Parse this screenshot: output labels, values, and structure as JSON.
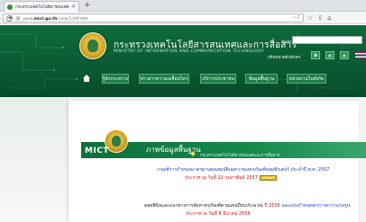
{
  "browser": {
    "tab_title": "กระทรวงเทคโนโลยีสารสนเทศ...",
    "tab_close": "×",
    "new_tab": "+",
    "url_prefix": "www.",
    "url_domain": "mict.go.th",
    "url_path": "/view/1/หน้าหลัก",
    "url_actions": "▿ C",
    "toolbar_icons": [
      "star-icon",
      "download-icon",
      "home-icon"
    ],
    "toolbar_glyphs": [
      "☆",
      "⇩",
      "⌂"
    ]
  },
  "header": {
    "title_th": "กระทรวงเทคโนโลยีสารสนเทศและการสื่อสาร",
    "title_en": "MINISTRY OF INFORMATION AND COMMUNICATION TECHNOLOGY",
    "search_label": "ค้นหา",
    "font_size_label": "ปรับขนาดตัวอักษร",
    "font_buttons": [
      "a",
      "ก",
      "ก"
    ],
    "menu": [
      "รู้จักกระทรวง",
      "ข่าวสารความเคลื่อนไหว",
      "บริการประชาชน",
      "ข้อมูลพื้นฐาน",
      "หน่วยงานในสังกัด"
    ]
  },
  "banner": {
    "logo_text": "MICT",
    "title": "ภาพข้อมูลพื้นฐาน",
    "subtitle": "กระทรวงเทคโนโลยีสารสนเทศและการสื่อสาร"
  },
  "notices": {
    "line1": "เกณฑ์การกำหนดมาตรฐานคุณสมบัติเฉพาะของครุภัณฑ์คอมพิวเตอร์ ประจำปี พ.ศ. 2557",
    "line2": "ประกาศ ณ วันที่ 21 กุมภาพันธ์ 2557",
    "badge": "UPDATE",
    "line3_a": "ดุลยพินิจและแนวทางการจัดหาครุภัณฑ์ตามแผนปีงบประมาณ",
    "line3_year": "ปี 2556",
    "line3_b": " และแบบกำหนดพาการดาราแรลรูน",
    "line4": "ประกาศ ณ วันที่ 8 มีนาคม 2556"
  }
}
